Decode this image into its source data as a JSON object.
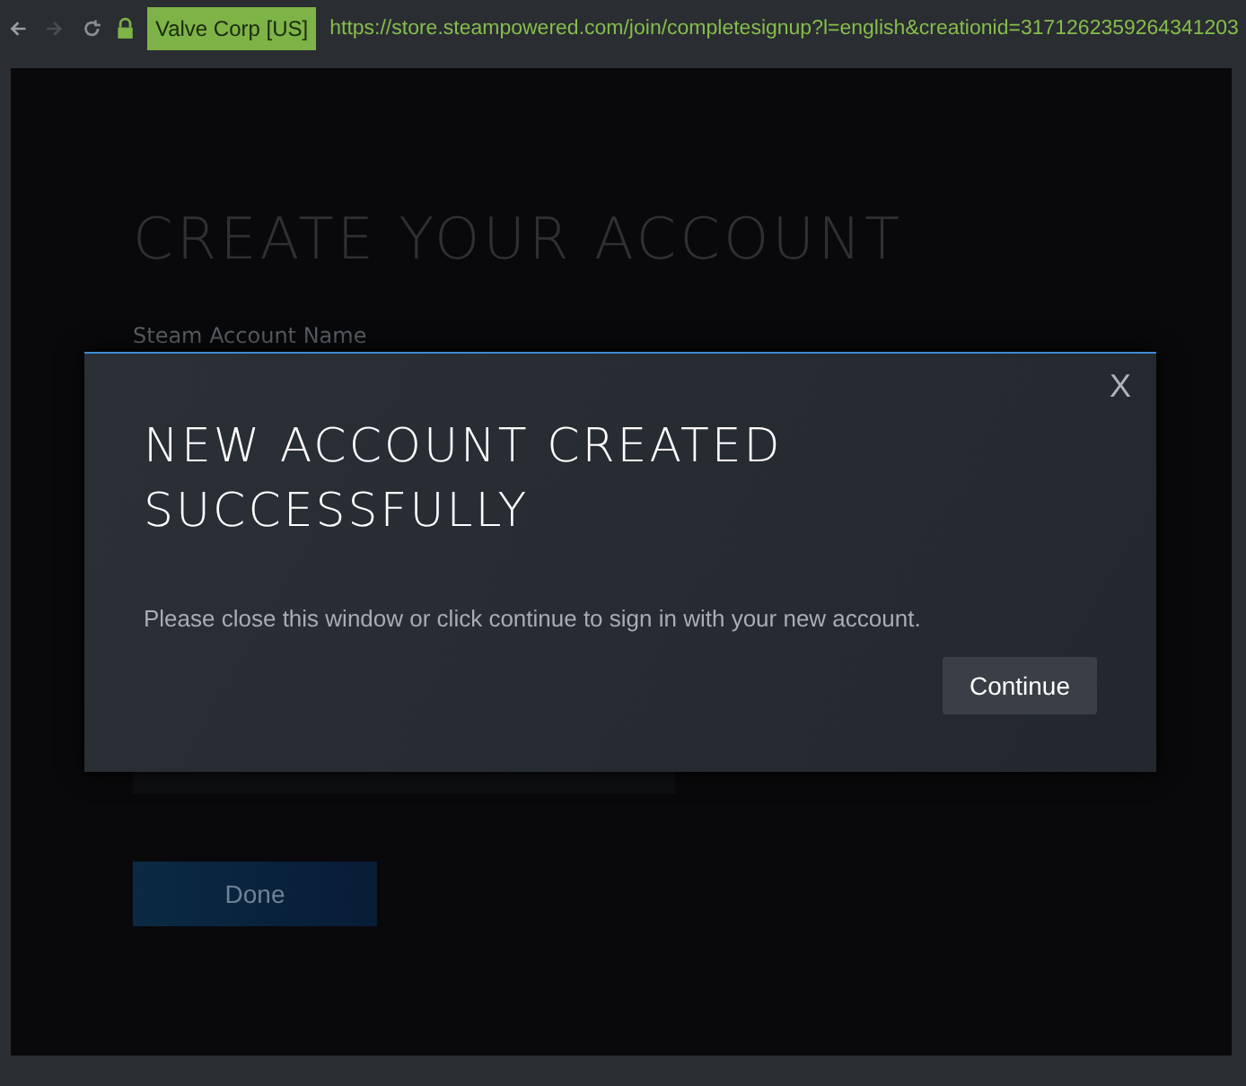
{
  "browser": {
    "certificate": "Valve Corp [US]",
    "url": "https://store.steampowered.com/join/completesignup?l=english&creationid=3171262359264341203"
  },
  "page": {
    "title": "CREATE YOUR ACCOUNT",
    "field_label": "Steam Account Name",
    "done_button": "Done"
  },
  "modal": {
    "close": "X",
    "title": "NEW ACCOUNT CREATED SUCCESSFULLY",
    "message": "Please close this window or click continue to sign in with your new account.",
    "button": "Continue"
  }
}
